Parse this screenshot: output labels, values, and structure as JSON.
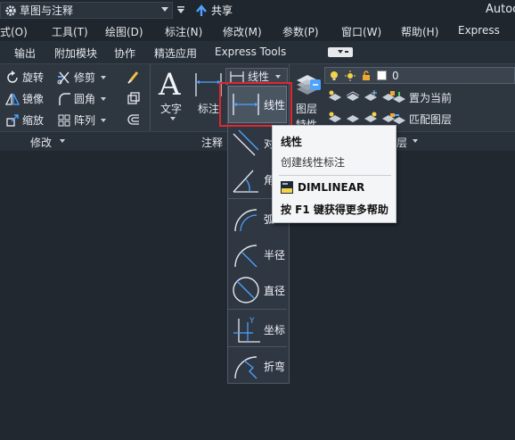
{
  "titlebar": {
    "workspace": "草图与注释",
    "share_label": "共享",
    "app_title": "Autoc"
  },
  "menu": [
    "式(O)",
    "工具(T)",
    "绘图(D)",
    "标注(N)",
    "修改(M)",
    "参数(P)",
    "窗口(W)",
    "帮助(H)",
    "Express"
  ],
  "ribbon_tabs": [
    "输出",
    "附加模块",
    "协作",
    "精选应用",
    "Express Tools"
  ],
  "modify_panel": {
    "rotate": "旋转",
    "trim": "修剪",
    "mirror": "镜像",
    "fillet": "圆角",
    "scale": "缩放",
    "array": "阵列",
    "title": "修改"
  },
  "annotation_panel": {
    "text": "文字",
    "dimension": "标注",
    "linear_combo": "线性",
    "title": "注释"
  },
  "layers_panel": {
    "current_layer": "0",
    "layer_props": "图层",
    "set_current": "置为当前",
    "match_layer": "匹配图层",
    "title_partial": "层",
    "partial_label": "特性"
  },
  "gallery": {
    "items": [
      {
        "label": "线性",
        "icon": "linear-dim-icon",
        "selected": true
      },
      {
        "label": "对",
        "icon": "aligned-dim-icon"
      },
      {
        "label": "角",
        "icon": "angular-dim-icon"
      },
      {
        "label": "弧",
        "icon": "arc-length-dim-icon"
      },
      {
        "label": "半径",
        "icon": "radius-dim-icon"
      },
      {
        "label": "直径",
        "icon": "diameter-dim-icon"
      },
      {
        "label": "坐标",
        "icon": "ordinate-dim-icon"
      },
      {
        "label": "折弯",
        "icon": "jogged-dim-icon"
      }
    ]
  },
  "tooltip": {
    "title": "线性",
    "description": "创建线性标注",
    "command": "DIMLINEAR",
    "help": "按 F1 键获得更多帮助"
  },
  "colors": {
    "highlight": "#e0262e",
    "background": "#212830",
    "ribbon": "#2e3640"
  }
}
